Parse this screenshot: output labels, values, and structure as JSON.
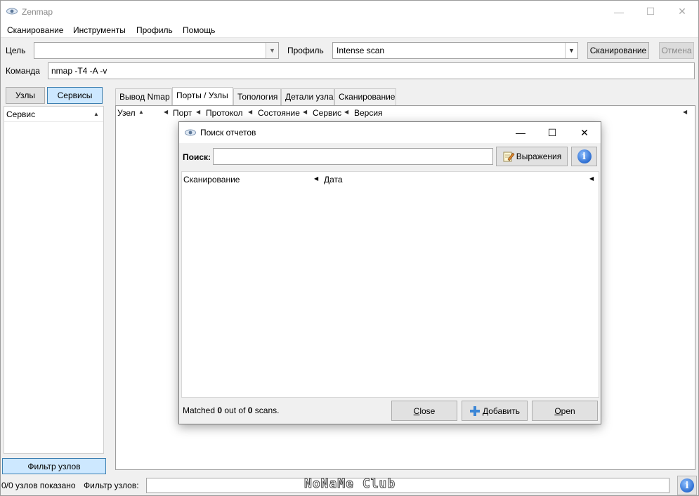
{
  "window": {
    "title": "Zenmap"
  },
  "menu": [
    "Сканирование",
    "Инструменты",
    "Профиль",
    "Помощь"
  ],
  "toolbar": {
    "target_label": "Цель",
    "target_value": "",
    "profile_label": "Профиль",
    "profile_value": "Intense scan",
    "scan_button": "Сканирование",
    "cancel_button": "Отмена",
    "command_label": "Команда",
    "command_value": "nmap -T4 -A -v"
  },
  "left": {
    "hosts_button": "Узлы",
    "services_button": "Сервисы",
    "header": "Сервис",
    "filter_button": "Фильтр узлов"
  },
  "tabs": [
    "Вывод Nmap",
    "Порты / Узлы",
    "Топология",
    "Детали узла",
    "Сканирование"
  ],
  "ports_table": {
    "columns": [
      "Узел",
      "Порт",
      "Протокол",
      "Состояние",
      "Сервис",
      "Версия"
    ]
  },
  "statusbar": {
    "hosts_shown": "0/0 узлов показано",
    "filter_label": "Фильтр узлов:",
    "filter_value": "",
    "watermark": "NoNaMe Club"
  },
  "dialog": {
    "title": "Поиск отчетов",
    "search_label": "Поиск:",
    "search_value": "",
    "expressions_button": "Выражения",
    "columns": [
      "Сканирование",
      "Дата"
    ],
    "matched_prefix": "Matched ",
    "matched_count": "0",
    "matched_mid": " out of ",
    "matched_total": "0",
    "matched_suffix": " scans.",
    "close_button": "Close",
    "add_button": "Добавить",
    "open_button": "Open"
  },
  "colors": {
    "accent_selected": "#cde8ff",
    "accent_border": "#3c7fb1",
    "info_blue": "#2d6ed1"
  }
}
